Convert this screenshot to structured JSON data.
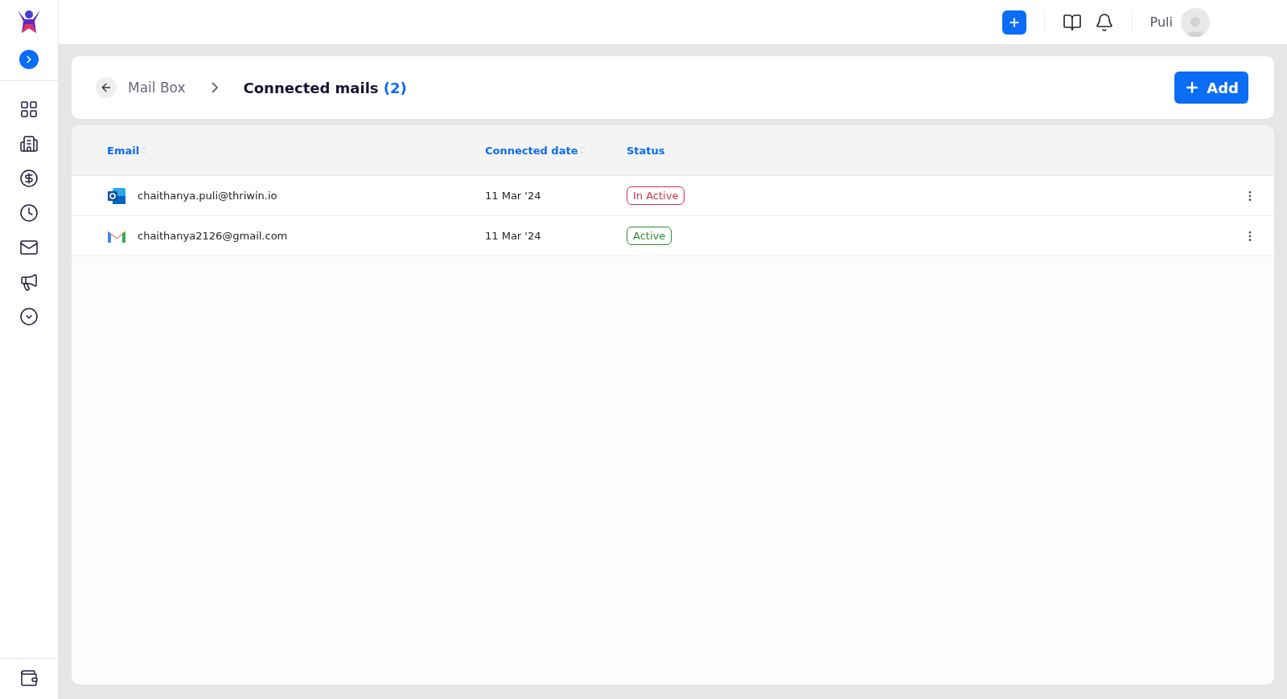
{
  "topbar": {
    "user_name": "Puli"
  },
  "breadcrumb": {
    "parent": "Mail Box",
    "current": "Connected mails",
    "count": "(2)"
  },
  "add_button": {
    "label": "Add"
  },
  "table": {
    "columns": [
      {
        "label": "Email",
        "sortable": true
      },
      {
        "label": "Connected date",
        "sortable": true
      },
      {
        "label": "Status",
        "sortable": false
      }
    ],
    "rows": [
      {
        "kind": "outlook",
        "email": "chaithanya.puli@thriwin.io",
        "date": "11 Mar '24",
        "status": {
          "label": "In Active",
          "kind": "inactive"
        }
      },
      {
        "kind": "gmail",
        "email": "chaithanya2126@gmail.com",
        "date": "11 Mar '24",
        "status": {
          "label": "Active",
          "kind": "active"
        }
      }
    ]
  }
}
